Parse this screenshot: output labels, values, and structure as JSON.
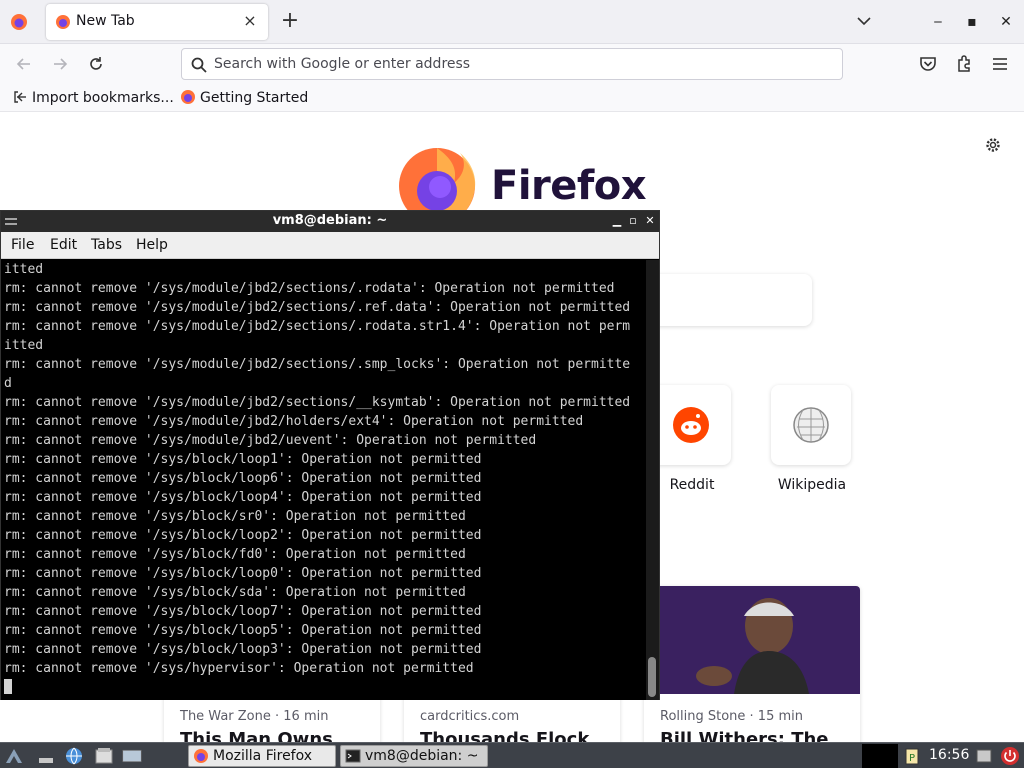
{
  "browser": {
    "tab_title": "New Tab",
    "tab_close": "×",
    "new_tab": "+",
    "address_placeholder": "Search with Google or enter address",
    "bookmarks": [
      {
        "label": "Import bookmarks..."
      },
      {
        "label": "Getting Started"
      }
    ],
    "window_controls": {
      "minimize": "‒",
      "maximize": "▪",
      "close": "✕"
    }
  },
  "newtab": {
    "brand_name": "Firefox",
    "shortcuts": [
      {
        "label": "Reddit",
        "icon": "reddit-icon",
        "color": "#ff4500"
      },
      {
        "label": "Wikipedia",
        "icon": "wikipedia-icon",
        "color": "#888888"
      }
    ],
    "stories": [
      {
        "source": "The War Zone · 16 min",
        "headline": "This Man Owns"
      },
      {
        "source": "cardcritics.com",
        "headline": "Thousands Flock"
      },
      {
        "source": "Rolling Stone · 15 min",
        "headline": "Bill Withers: The"
      }
    ]
  },
  "terminal": {
    "title": "vm8@debian: ~",
    "menu": [
      "File",
      "Edit",
      "Tabs",
      "Help"
    ],
    "lines": [
      "itted",
      "rm: cannot remove '/sys/module/jbd2/sections/.rodata': Operation not permitted",
      "rm: cannot remove '/sys/module/jbd2/sections/.ref.data': Operation not permitted",
      "rm: cannot remove '/sys/module/jbd2/sections/.rodata.str1.4': Operation not perm",
      "itted",
      "rm: cannot remove '/sys/module/jbd2/sections/.smp_locks': Operation not permitte",
      "d",
      "rm: cannot remove '/sys/module/jbd2/sections/__ksymtab': Operation not permitted",
      "rm: cannot remove '/sys/module/jbd2/holders/ext4': Operation not permitted",
      "rm: cannot remove '/sys/module/jbd2/uevent': Operation not permitted",
      "rm: cannot remove '/sys/block/loop1': Operation not permitted",
      "rm: cannot remove '/sys/block/loop6': Operation not permitted",
      "rm: cannot remove '/sys/block/loop4': Operation not permitted",
      "rm: cannot remove '/sys/block/sr0': Operation not permitted",
      "rm: cannot remove '/sys/block/loop2': Operation not permitted",
      "rm: cannot remove '/sys/block/fd0': Operation not permitted",
      "rm: cannot remove '/sys/block/loop0': Operation not permitted",
      "rm: cannot remove '/sys/block/sda': Operation not permitted",
      "rm: cannot remove '/sys/block/loop7': Operation not permitted",
      "rm: cannot remove '/sys/block/loop5': Operation not permitted",
      "rm: cannot remove '/sys/block/loop3': Operation not permitted",
      "rm: cannot remove '/sys/hypervisor': Operation not permitted"
    ]
  },
  "taskbar": {
    "tasks": [
      {
        "label": "Mozilla Firefox"
      },
      {
        "label": "vm8@debian: ~"
      }
    ],
    "clock": "16:56"
  },
  "colors": {
    "firefox_orange": "#ff7139",
    "firefox_purple": "#7542e5",
    "terminal_bg": "#000000",
    "terminal_fg": "#d3d3d3",
    "taskbar_bg": "#3d4148"
  }
}
